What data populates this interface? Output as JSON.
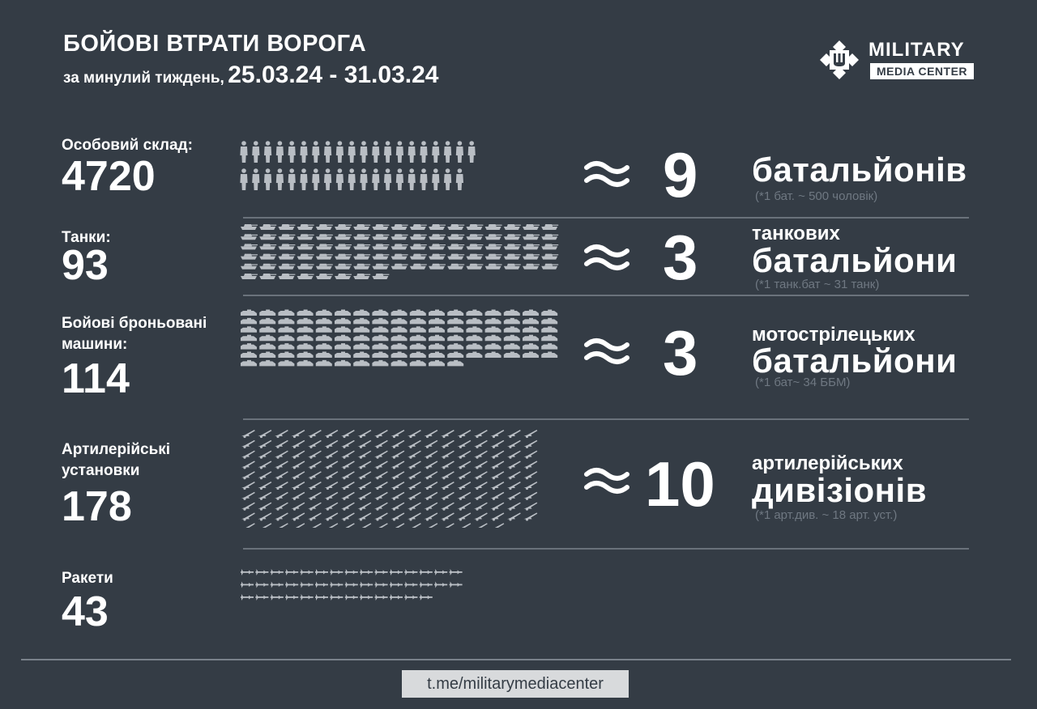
{
  "header": {
    "title": "БОЙОВІ ВТРАТИ ВОРОГА",
    "subtitle_prefix": "за минулий тиждень,",
    "dates": "25.03.24 - 31.03.24"
  },
  "logo": {
    "line1": "MILITARY",
    "line2": "MEDIA CENTER"
  },
  "rows": {
    "personnel": {
      "label": "Особовий склад:",
      "count": "4720",
      "equals": "9",
      "unit_small": "",
      "unit_big": "батальйонів",
      "note": "(*1 бат. ~ 500 чоловік)",
      "icon": "soldier-icon",
      "icons_shown": 39
    },
    "tanks": {
      "label": "Танки:",
      "count": "93",
      "equals": "3",
      "unit_small": "танкових",
      "unit_big": "батальйони",
      "note": "(*1 танк.бат ~ 31 танк)",
      "icon": "tank-icon",
      "icons_shown": 93
    },
    "afv": {
      "label_line1": "Бойові броньовані",
      "label_line2": "машини:",
      "count": "114",
      "equals": "3",
      "unit_small": "мотострілецьких",
      "unit_big": "батальйони",
      "note": "(*1 бат~ 34 ББМ)",
      "icon": "armored-vehicle-icon",
      "icons_shown": 114
    },
    "artillery": {
      "label_line1": "Артилерійські",
      "label_line2": "установки",
      "count": "178",
      "equals": "10",
      "unit_small": "артилерійських",
      "unit_big": "дивізіонів",
      "note": "(*1 арт.див. ~ 18 арт. уст.)",
      "icon": "artillery-icon",
      "icons_shown": 178
    },
    "missiles": {
      "label": "Ракети",
      "count": "43",
      "icon": "missile-icon",
      "icons_shown": 43
    }
  },
  "symbols": {
    "approx": "≈"
  },
  "footer": {
    "link": "t.me/militarymediacenter"
  },
  "colors": {
    "background": "#343c45",
    "icon_fill": "#b9bec4",
    "separator": "#6a727b",
    "note_text": "#6f7882"
  }
}
